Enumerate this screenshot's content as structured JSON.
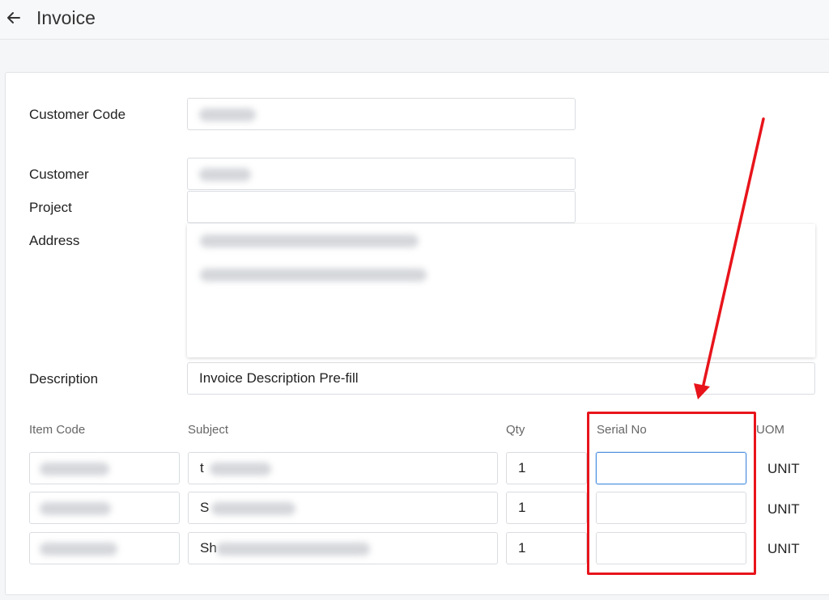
{
  "header": {
    "title": "Invoice",
    "back_icon": "arrow-left-icon"
  },
  "form": {
    "customer_code_label": "Customer Code",
    "customer_label": "Customer",
    "project_label": "Project",
    "address_label": "Address",
    "description_label": "Description",
    "description_value": "Invoice Description Pre-fill",
    "project_value": ""
  },
  "items": {
    "columns": [
      "Item Code",
      "Subject",
      "Qty",
      "Serial No",
      "UOM"
    ],
    "rows": [
      {
        "subject_prefix": "t",
        "qty": "1",
        "serial": "",
        "uom": "UNIT"
      },
      {
        "subject_prefix": "S",
        "qty": "1",
        "serial": "",
        "uom": "UNIT"
      },
      {
        "subject_prefix": "Sh",
        "qty": "1",
        "serial": "",
        "uom": "UNIT"
      }
    ]
  },
  "annotation": {
    "color": "#e8141b"
  }
}
